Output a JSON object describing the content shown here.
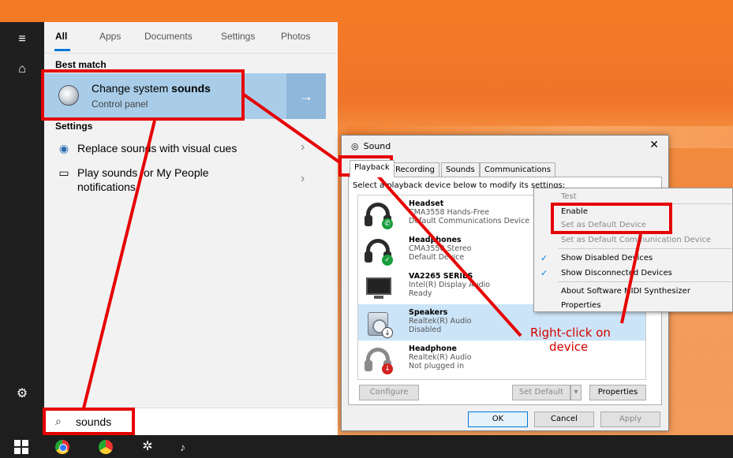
{
  "start_menu": {
    "tabs": [
      "All",
      "Apps",
      "Documents",
      "Settings",
      "Photos"
    ],
    "best_match_label": "Best match",
    "best_match": {
      "title_prefix": "Change system ",
      "title_bold": "sounds",
      "subtitle": "Control panel",
      "arrow": "→"
    },
    "settings_label": "Settings",
    "settings_items": [
      {
        "label": "Replace sounds with visual cues",
        "icon": "visual-cues-icon",
        "chevron": "›"
      },
      {
        "label": "Play sounds for My People notifications",
        "icon": "monitor-icon",
        "chevron": "›"
      }
    ],
    "search": {
      "value": "sounds",
      "icon": "⌕"
    },
    "rail_icons": [
      "hamburger-icon",
      "home-icon",
      "settings-gear-icon"
    ]
  },
  "taskbar": {
    "icons": [
      "windows-logo-icon",
      "chrome-icon",
      "chrome-profile-icon",
      "settings-icon",
      "sound-icon"
    ]
  },
  "sound_dialog": {
    "title": "Sound",
    "close": "✕",
    "tabs": [
      "Playback",
      "Recording",
      "Sounds",
      "Communications"
    ],
    "instruction": "Select a playback device below to modify its settings:",
    "devices": [
      {
        "name": "Headset",
        "line2": "CMA3558 Hands-Free",
        "line3": "Default Communications Device",
        "icon": "headset-icon",
        "badge": "phone",
        "selected": false
      },
      {
        "name": "Headphones",
        "line2": "CMA3558 Stereo",
        "line3": "Default Device",
        "icon": "headphones-icon",
        "badge": "check",
        "selected": false
      },
      {
        "name": "VA2265 SERIES",
        "line2": "Intel(R) Display Audio",
        "line3": "Ready",
        "icon": "monitor-icon",
        "badge": "",
        "selected": false
      },
      {
        "name": "Speakers",
        "line2": "Realtek(R) Audio",
        "line3": "Disabled",
        "icon": "speaker-icon",
        "badge": "down",
        "selected": true
      },
      {
        "name": "Headphone",
        "line2": "Realtek(R) Audio",
        "line3": "Not plugged in",
        "icon": "headphones-icon",
        "badge": "red-down",
        "selected": false
      }
    ],
    "buttons": {
      "configure": "Configure",
      "set_default": "Set Default",
      "properties": "Properties",
      "ok": "OK",
      "cancel": "Cancel",
      "apply": "Apply"
    }
  },
  "context_menu": {
    "items": [
      {
        "label": "Test",
        "disabled": true,
        "checked": false
      },
      {
        "label": "Enable",
        "disabled": false,
        "checked": false
      },
      {
        "label": "Set as Default Device",
        "disabled": true,
        "checked": false
      },
      {
        "label": "Set as Default Communication Device",
        "disabled": true,
        "checked": false
      },
      {
        "label": "Show Disabled Devices",
        "disabled": false,
        "checked": true
      },
      {
        "label": "Show Disconnected Devices",
        "disabled": false,
        "checked": true
      },
      {
        "label": "About Software MIDI Synthesizer",
        "disabled": false,
        "checked": false
      },
      {
        "label": "Properties",
        "disabled": false,
        "checked": false
      }
    ]
  },
  "annotation": {
    "callout_line1": "Right-click on",
    "callout_line2": "device",
    "color": "#e60000"
  }
}
